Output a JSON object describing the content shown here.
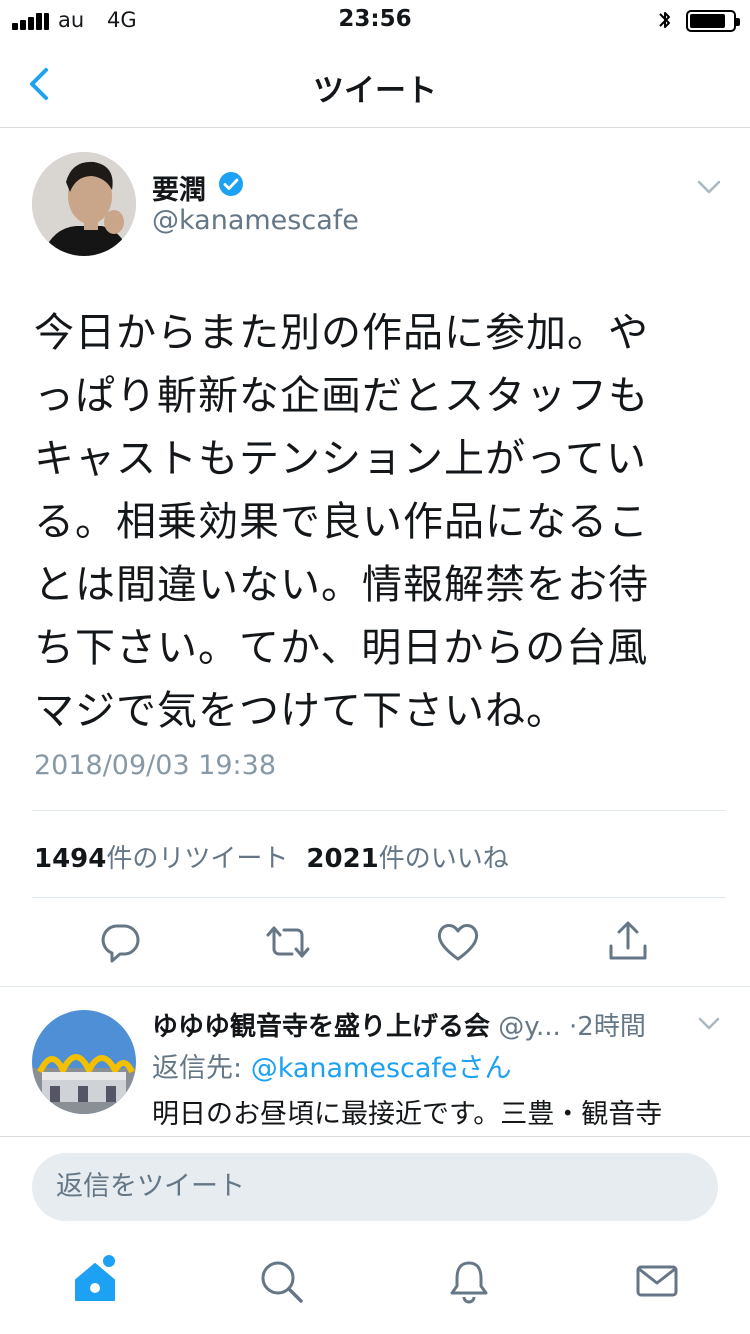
{
  "status_bar": {
    "carrier": "au",
    "network": "4G",
    "time": "23:56"
  },
  "nav": {
    "title": "ツイート",
    "back_icon": "chevron-left-icon"
  },
  "tweet": {
    "display_name": "要潤",
    "verified": true,
    "handle": "@kanamescafe",
    "text_lines": [
      "今日からまた別の作品に参加。や",
      "っぱり斬新な企画だとスタッフも",
      "キャストもテンション上がってい",
      "る。相乗効果で良い作品になるこ",
      "とは間違いない。情報解禁をお待",
      "ち下さい。てか、明日からの台風",
      "マジで気をつけて下さいね。"
    ],
    "date": "2018/09/03 19:38",
    "retweet_count": "1494",
    "retweet_label": "件のリツイート",
    "like_count": "2021",
    "like_label": "件のいいね"
  },
  "reply": {
    "name": "ゆゆゆ観音寺を盛り上げる会",
    "handle": "@y...",
    "separator": "·",
    "time": "2時間",
    "reply_to_label": "返信先: ",
    "reply_to_mention": "@kanamescafeさん",
    "text": "明日のお昼頃に最接近です。三豊・観音寺"
  },
  "composer": {
    "placeholder": "返信をツイート"
  },
  "tab_bar": {
    "items": [
      "home-icon",
      "search-icon",
      "notifications-icon",
      "messages-icon"
    ]
  },
  "colors": {
    "accent": "#1da1f2",
    "secondary_text": "#657786",
    "divider": "#e1e8ed"
  }
}
